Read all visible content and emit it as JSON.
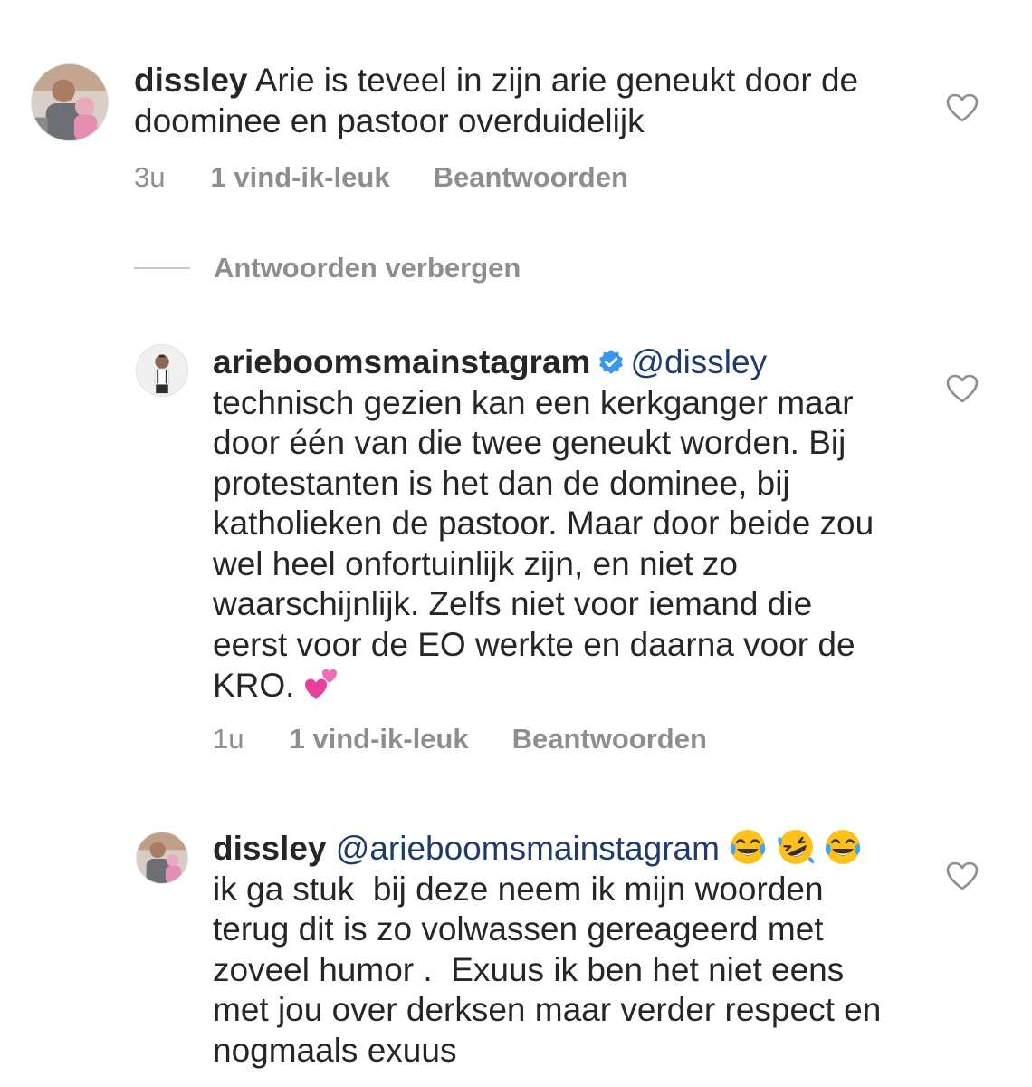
{
  "comments": [
    {
      "username": "dissley",
      "text": "Arie is teveel in zijn arie geneukt door de doominee en pastoor overduidelijk",
      "time": "3u",
      "likes": "1 vind-ik-leuk",
      "reply_label": "Beantwoorden"
    },
    {
      "username": "arieboomsmainstagram",
      "verified": true,
      "mention": "@dissley",
      "text": "technisch gezien kan een kerkganger maar door één van die twee geneukt worden. Bij protestanten is het dan de dominee, bij katholieken de pastoor. Maar door beide zou wel heel onfortuinlijk zijn, en niet zo waarschijnlijk. Zelfs niet voor iemand die eerst voor de EO werkte en daarna voor de KRO.",
      "emoji": "two-hearts-icon",
      "time": "1u",
      "likes": "1 vind-ik-leuk",
      "reply_label": "Beantwoorden"
    },
    {
      "username": "dissley",
      "mention": "@arieboomsmainstagram",
      "text": "ik ga stuk  bij deze neem ik mijn woorden terug dit is zo volwassen gereageerd met zoveel humor .  Exuus ik ben het niet eens met jou over derksen maar verder respect en nogmaals exuus"
    }
  ],
  "hide_replies_label": "Antwoorden verbergen",
  "colors": {
    "text": "#262626",
    "meta": "#8e8e8e",
    "mention": "#1f3b6e",
    "verified": "#3897f0",
    "heart_outline": "#8e8e8e"
  },
  "icons": [
    "heart-outline-icon",
    "verified-badge-icon",
    "two-hearts-icon",
    "face-with-tears-of-joy-icon",
    "rolling-on-floor-laughing-icon"
  ]
}
